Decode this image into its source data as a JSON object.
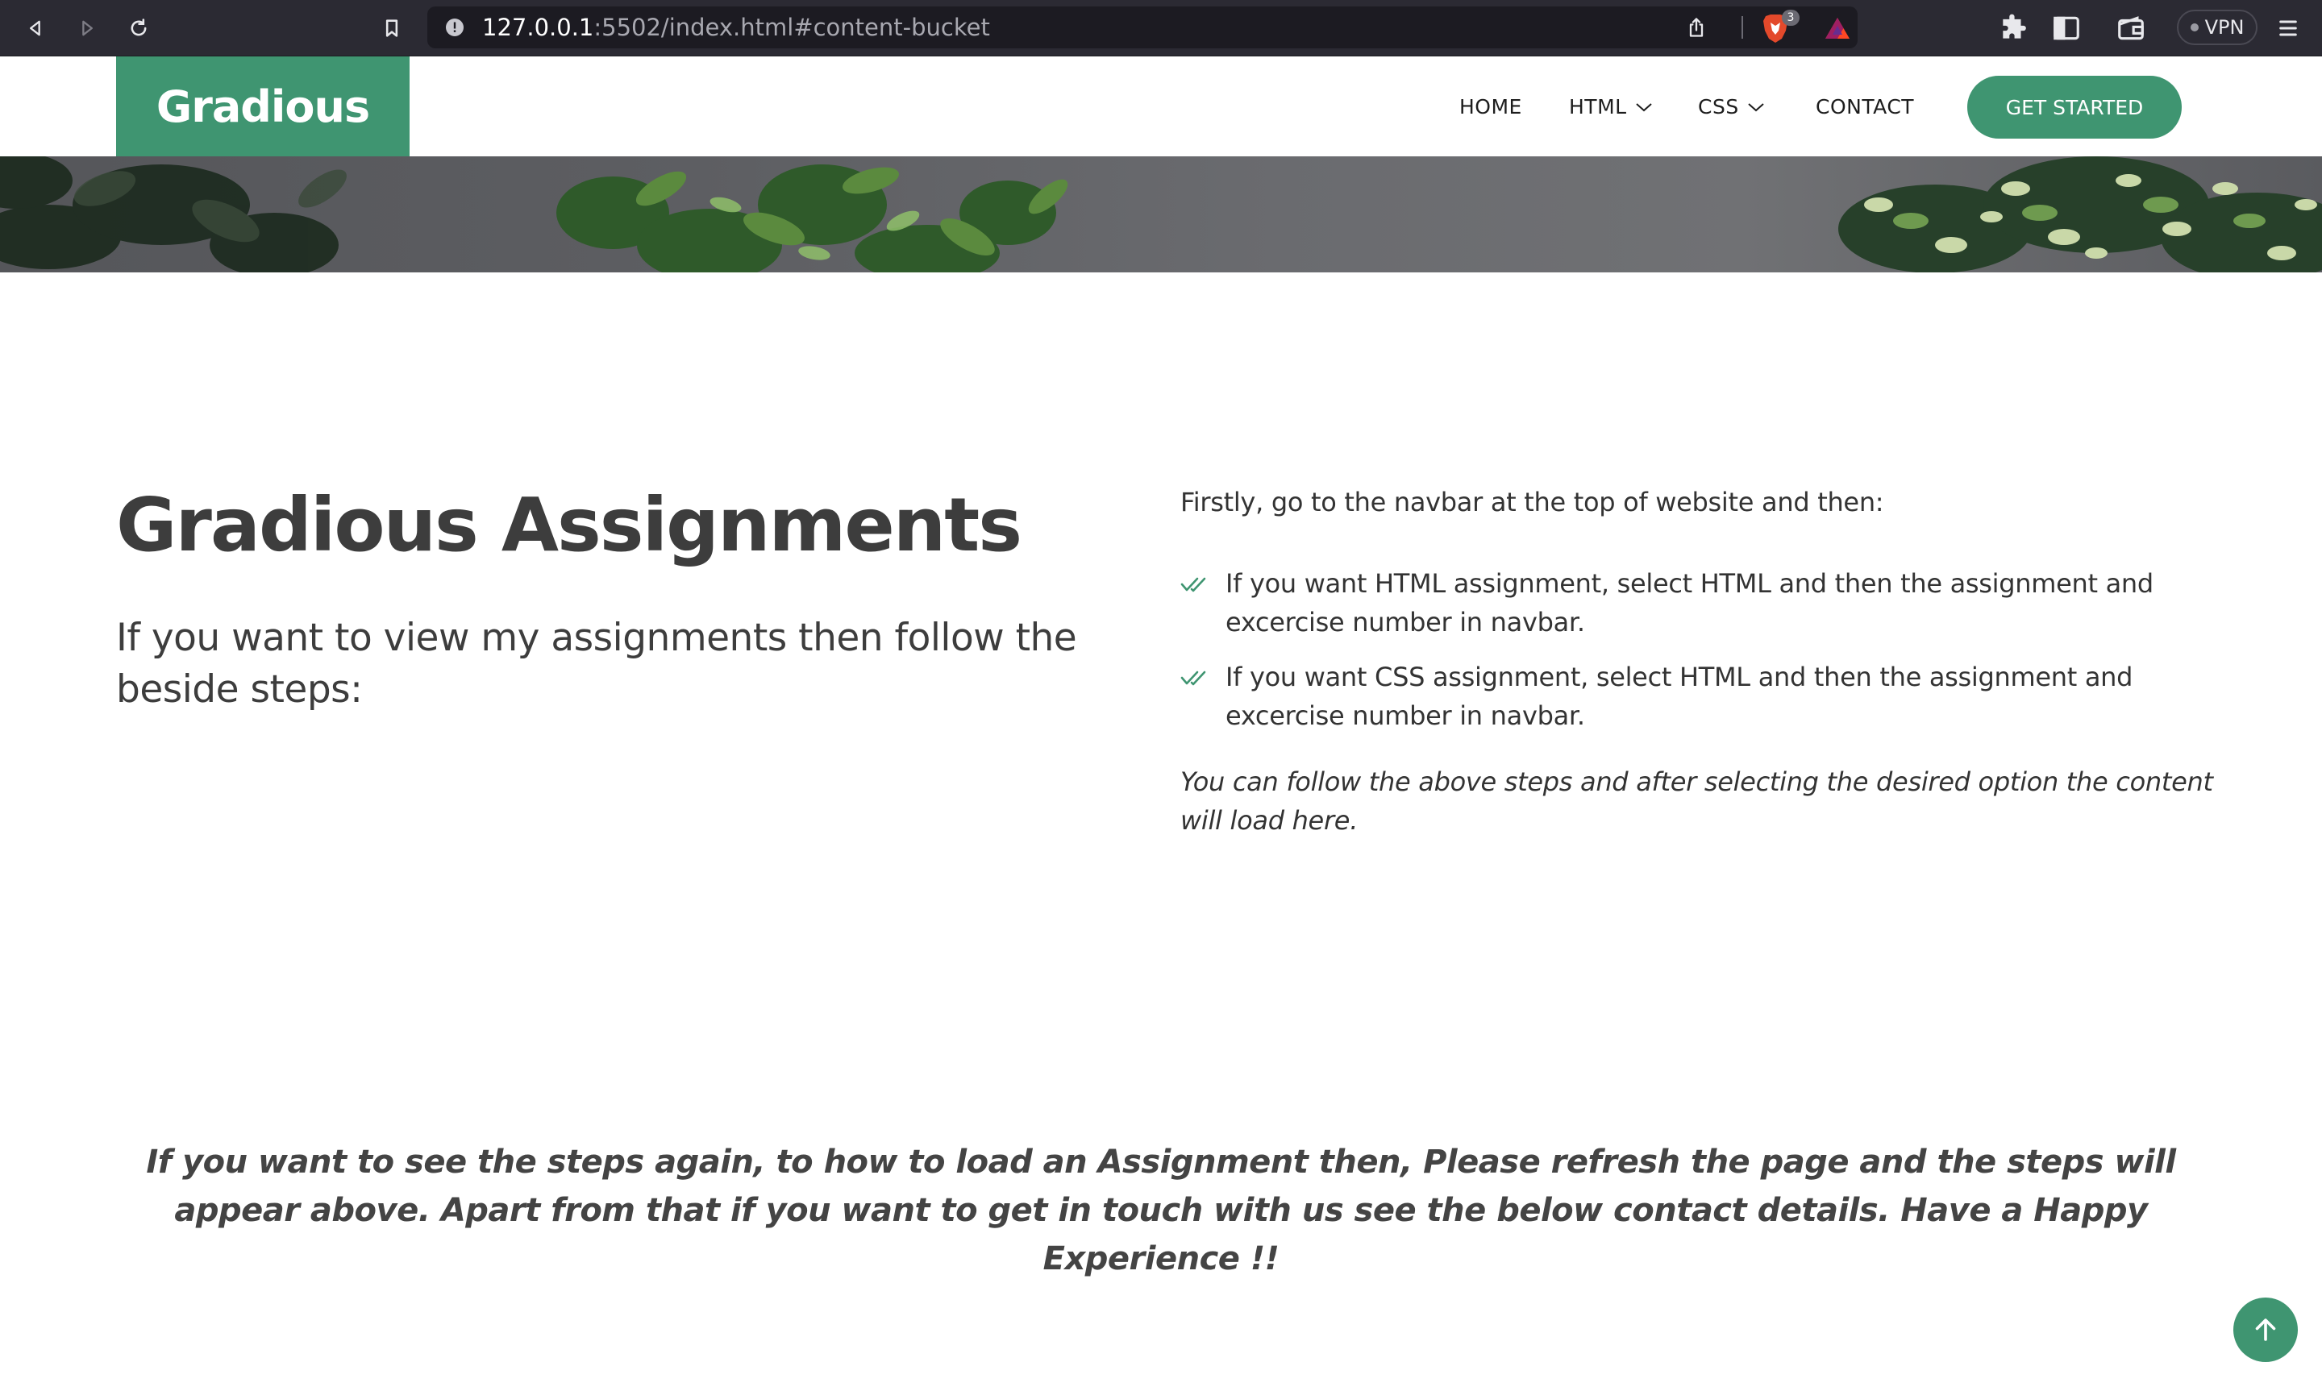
{
  "browser": {
    "url_host": "127.0.0.1",
    "url_rest": ":5502/index.html#content-bucket",
    "shields_count": "3",
    "vpn_label": "VPN"
  },
  "header": {
    "logo": "Gradious",
    "nav": {
      "home": "HOME",
      "html": "HTML",
      "css": "CSS",
      "contact": "CONTACT"
    },
    "cta": "GET STARTED"
  },
  "content": {
    "title": "Gradious Assignments",
    "subtitle": "If you want to view my assignments then follow the beside steps:",
    "intro": "Firstly, go to the navbar at the top of website and then:",
    "steps": [
      "If you want HTML assignment, select HTML and then the assignment and excercise number in navbar.",
      "If you want CSS assignment, select HTML and then the assignment and excercise number in navbar."
    ],
    "note": "You can follow the above steps and after selecting the desired option the content will load here.",
    "footer_note": "If you want to see the steps again, to how to load an Assignment then, Please refresh the page and the steps will appear above. Apart from that if you want to get in touch with us see the below contact details. Have a Happy Experience !!"
  },
  "colors": {
    "accent": "#3f9571",
    "text": "#3d3d3d",
    "chrome_bg": "#2b2a33"
  },
  "icons": {
    "back": "back-arrow-icon",
    "forward": "forward-arrow-icon",
    "reload": "reload-icon",
    "bookmark": "bookmark-icon",
    "site_info": "info-icon",
    "share": "share-icon",
    "brave_shields": "brave-lion-icon",
    "rewards": "bat-triangle-icon",
    "extensions": "puzzle-icon",
    "sidebar": "sidebar-icon",
    "wallet": "wallet-icon",
    "menu": "hamburger-icon",
    "dropdown": "chevron-down-icon",
    "check": "double-check-icon",
    "back_to_top": "arrow-up-icon"
  }
}
